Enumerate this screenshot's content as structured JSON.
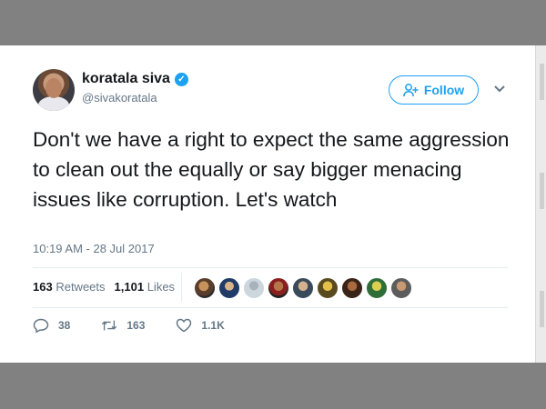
{
  "tweet": {
    "author_name": "koratala siva",
    "author_handle": "@sivakoratala",
    "verified_mark": "✓",
    "follow_label": "Follow",
    "text": "Don't we have a right to expect the same aggression to clean out the equally or say bigger menacing issues like corruption. Let's watch",
    "timestamp": "10:19 AM - 28 Jul 2017"
  },
  "stats": {
    "retweets_count": "163",
    "retweets_label": "Retweets",
    "likes_count": "1,101",
    "likes_label": "Likes"
  },
  "actions": {
    "reply_count": "38",
    "retweet_count": "163",
    "like_count": "1.1K"
  },
  "colors": {
    "accent": "#1da1f2",
    "text": "#14171a",
    "muted": "#657786"
  },
  "icons": [
    "verified-badge-icon",
    "follow-person-icon",
    "chevron-down-icon",
    "reply-icon",
    "retweet-icon",
    "heart-icon"
  ]
}
